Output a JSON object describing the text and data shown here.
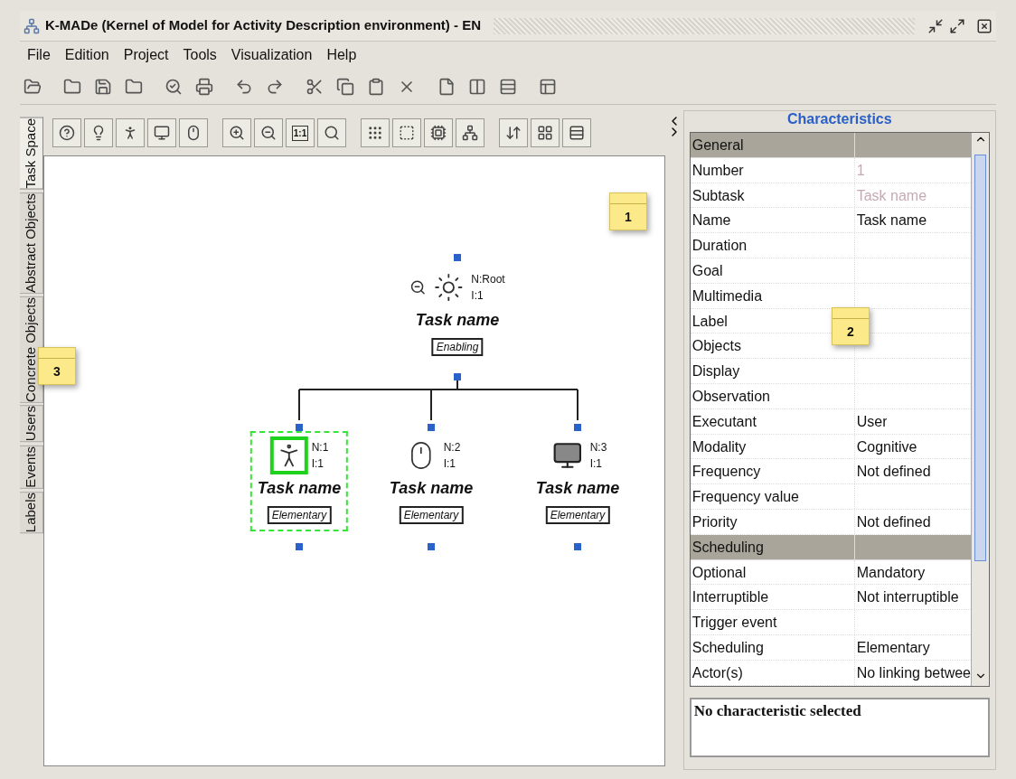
{
  "window": {
    "title": "K-MADe (Kernel of Model for Activity Description environment) - EN"
  },
  "menu": [
    {
      "label": "File"
    },
    {
      "label": "Edition"
    },
    {
      "label": "Project"
    },
    {
      "label": "Tools"
    },
    {
      "label": "Visualization"
    },
    {
      "label": "Help"
    }
  ],
  "canvas_toolbar": {
    "zoom_label": "1:1"
  },
  "side_tabs": [
    {
      "label": "Task Space",
      "selected": true
    },
    {
      "label": "Abstract Objects",
      "selected": false
    },
    {
      "label": "Concrete Objects",
      "selected": false
    },
    {
      "label": "Users",
      "selected": false
    },
    {
      "label": "Events",
      "selected": false
    },
    {
      "label": "Labels",
      "selected": false
    }
  ],
  "diagram": {
    "root": {
      "kind": "abstract",
      "name": "Task name",
      "number": "N:Root",
      "iteration": "I:1",
      "scheduling": "Enabling",
      "selected": false
    },
    "children": [
      {
        "kind": "user",
        "name": "Task name",
        "number": "N:1",
        "iteration": "I:1",
        "scheduling": "Elementary",
        "selected": true
      },
      {
        "kind": "interaction",
        "name": "Task name",
        "number": "N:2",
        "iteration": "I:1",
        "scheduling": "Elementary",
        "selected": false
      },
      {
        "kind": "system",
        "name": "Task name",
        "number": "N:3",
        "iteration": "I:1",
        "scheduling": "Elementary",
        "selected": false
      }
    ]
  },
  "characteristics": {
    "title": "Characteristics",
    "rows": [
      {
        "kind": "section",
        "label": "General"
      },
      {
        "kind": "row",
        "label": "Number",
        "value": "1",
        "disabled": true
      },
      {
        "kind": "row",
        "label": "Subtask",
        "value": "Task name",
        "disabled": true
      },
      {
        "kind": "row",
        "label": "Name",
        "value": "Task name",
        "disabled": false
      },
      {
        "kind": "row",
        "label": "Duration"
      },
      {
        "kind": "row",
        "label": "Goal"
      },
      {
        "kind": "row",
        "label": "Multimedia"
      },
      {
        "kind": "row",
        "label": "Label"
      },
      {
        "kind": "row",
        "label": "Objects"
      },
      {
        "kind": "row",
        "label": "Display"
      },
      {
        "kind": "row",
        "label": "Observation"
      },
      {
        "kind": "row",
        "label": "Executant",
        "value": "User",
        "disabled": false
      },
      {
        "kind": "row",
        "label": "Modality",
        "value": "Cognitive",
        "disabled": false
      },
      {
        "kind": "row",
        "label": "Frequency",
        "value": "Not defined",
        "disabled": false
      },
      {
        "kind": "row",
        "label": "Frequency value"
      },
      {
        "kind": "row",
        "label": "Priority",
        "value": "Not defined",
        "disabled": false
      },
      {
        "kind": "section",
        "label": "Scheduling"
      },
      {
        "kind": "row",
        "label": "Optional",
        "value": "Mandatory",
        "disabled": false
      },
      {
        "kind": "row",
        "label": "Interruptible",
        "value": "Not interruptible",
        "disabled": false
      },
      {
        "kind": "row",
        "label": "Trigger event"
      },
      {
        "kind": "row",
        "label": "Scheduling",
        "value": "Elementary",
        "disabled": false
      },
      {
        "kind": "row",
        "label": "Actor(s)",
        "value": "No linking betwee",
        "disabled": false
      }
    ],
    "description": "No characteristic selected"
  },
  "notes": [
    {
      "text": "1"
    },
    {
      "text": "2"
    },
    {
      "text": "3"
    }
  ]
}
